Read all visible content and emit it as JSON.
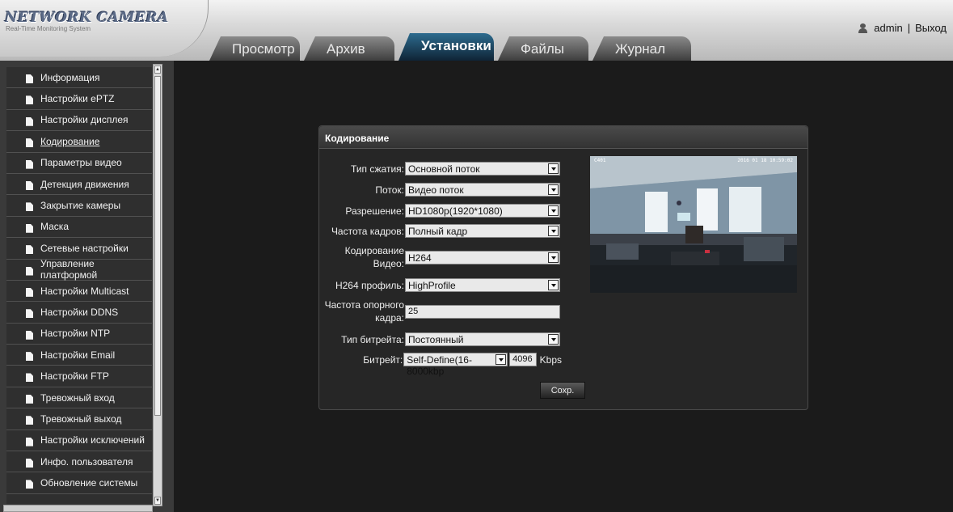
{
  "header": {
    "logo": "NETWORK CAMERA",
    "logo_sub": "Real-Time Monitoring System",
    "tabs": [
      {
        "label": "Просмотр"
      },
      {
        "label": "Архив"
      },
      {
        "label": "Установки"
      },
      {
        "label": "Файлы"
      },
      {
        "label": "Журнал"
      }
    ],
    "active_tab": "Установки",
    "user": "admin",
    "separator": "|",
    "logout": "Выход"
  },
  "sidebar": {
    "items": [
      {
        "label": "Информация"
      },
      {
        "label": "Настройки ePTZ"
      },
      {
        "label": "Настройки дисплея"
      },
      {
        "label": "Кодирование"
      },
      {
        "label": "Параметры видео"
      },
      {
        "label": "Детекция движения"
      },
      {
        "label": "Закрытие камеры"
      },
      {
        "label": "Маска"
      },
      {
        "label": "Сетевые настройки"
      },
      {
        "label": "Управление платформой"
      },
      {
        "label": "Настройки Multicast"
      },
      {
        "label": "Настройки DDNS"
      },
      {
        "label": "Настройки NTP"
      },
      {
        "label": "Настройки Email"
      },
      {
        "label": "Настройки FTP"
      },
      {
        "label": "Тревожный вход"
      },
      {
        "label": "Тревожный выход"
      },
      {
        "label": "Настройки исключений"
      },
      {
        "label": "Инфо. пользователя"
      },
      {
        "label": "Обновление системы"
      }
    ],
    "active_index": 3
  },
  "panel": {
    "title": "Кодирование",
    "fields": {
      "compression": {
        "label": "Тип сжатия:",
        "value": "Основной поток"
      },
      "stream": {
        "label": "Поток:",
        "value": "Видео поток"
      },
      "resolution": {
        "label": "Разрешение:",
        "value": "HD1080p(1920*1080)"
      },
      "framerate": {
        "label": "Частота кадров:",
        "value": "Полный кадр"
      },
      "video_encoding": {
        "label": "Кодирование Видео:",
        "value": "H264"
      },
      "h264_profile": {
        "label": "H264 профиль:",
        "value": "HighProfile"
      },
      "keyframe": {
        "label": "Частота опорного кадра:",
        "value": "25"
      },
      "bitrate_type": {
        "label": "Тип битрейта:",
        "value": "Постоянный"
      },
      "bitrate": {
        "label": "Битрейт:",
        "value": "Self-Define(16-8000kbp",
        "custom": "4096",
        "unit": "Kbps"
      }
    },
    "save_label": "Сохр.",
    "preview": {
      "osd_left": "C401",
      "osd_right": "2016 01 18 10:59:02"
    }
  }
}
